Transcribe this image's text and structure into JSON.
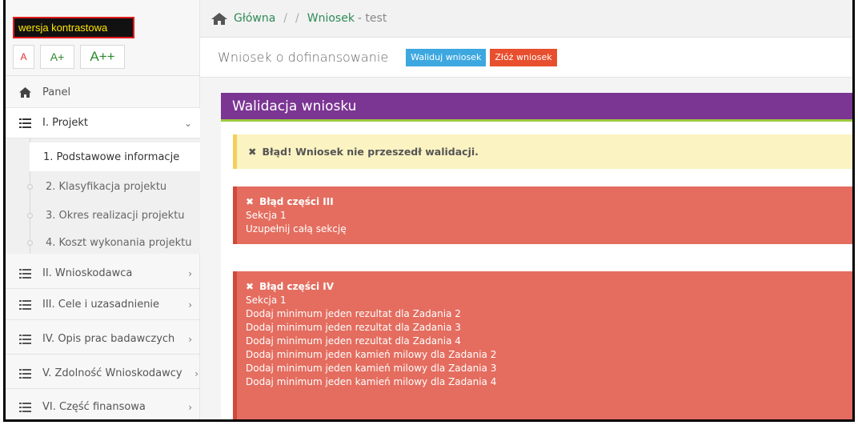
{
  "accessibility": {
    "contrast_label": "wersja kontrastowa",
    "size_small": "A",
    "size_medium": "A+",
    "size_large": "A++"
  },
  "sidebar": {
    "items": [
      {
        "label": "Panel",
        "icon": "home-icon"
      },
      {
        "label": "I. Projekt",
        "icon": "list-icon",
        "expanded": true
      },
      {
        "label": "II. Wnioskodawca",
        "icon": "list-icon"
      },
      {
        "label": "III. Cele i uzasadnienie",
        "icon": "list-icon"
      },
      {
        "label": "IV. Opis prac badawczych",
        "icon": "list-icon"
      },
      {
        "label": "V. Zdolność Wnioskodawcy",
        "icon": "list-icon"
      },
      {
        "label": "VI. Część finansowa",
        "icon": "list-icon"
      }
    ],
    "subitems": [
      {
        "label": "1. Podstawowe informacje",
        "active": true
      },
      {
        "label": "2. Klasyfikacja projektu"
      },
      {
        "label": "3. Okres realizacji projektu"
      },
      {
        "label": "4. Koszt wykonania projektu"
      }
    ]
  },
  "breadcrumb": {
    "home": "Główna",
    "sep1": "/",
    "sep2": "/",
    "current_link": "Wniosek",
    "current_suffix": "- test"
  },
  "subbar": {
    "title": "Wniosek o dofinansowanie",
    "validate_label": "Waliduj wniosek",
    "submit_label": "Złóż wniosek"
  },
  "panel": {
    "title": "Walidacja wniosku",
    "warning": "Błąd! Wniosek nie przeszedł walidacji.",
    "errors": [
      {
        "title": "Błąd części III",
        "lines": [
          "Sekcja 1",
          "Uzupełnij całą sekcję"
        ]
      },
      {
        "title": "Błąd części IV",
        "lines": [
          "Sekcja 1",
          "Dodaj minimum jeden rezultat dla Zadania 2",
          "Dodaj minimum jeden rezultat dla Zadania 3",
          "Dodaj minimum jeden rezultat dla Zadania 4",
          "Dodaj minimum jeden kamień milowy dla Zadania 2",
          "Dodaj minimum jeden kamień milowy dla Zadania 3",
          "Dodaj minimum jeden kamień milowy dla Zadania 4"
        ]
      }
    ]
  },
  "colors": {
    "header_purple": "#7b3593",
    "error_red": "#e46d5f",
    "warning_yellow": "#fcf3c2",
    "validate_blue": "#3da7e0",
    "submit_red": "#e84f2e",
    "link_green": "#2e8b57"
  }
}
